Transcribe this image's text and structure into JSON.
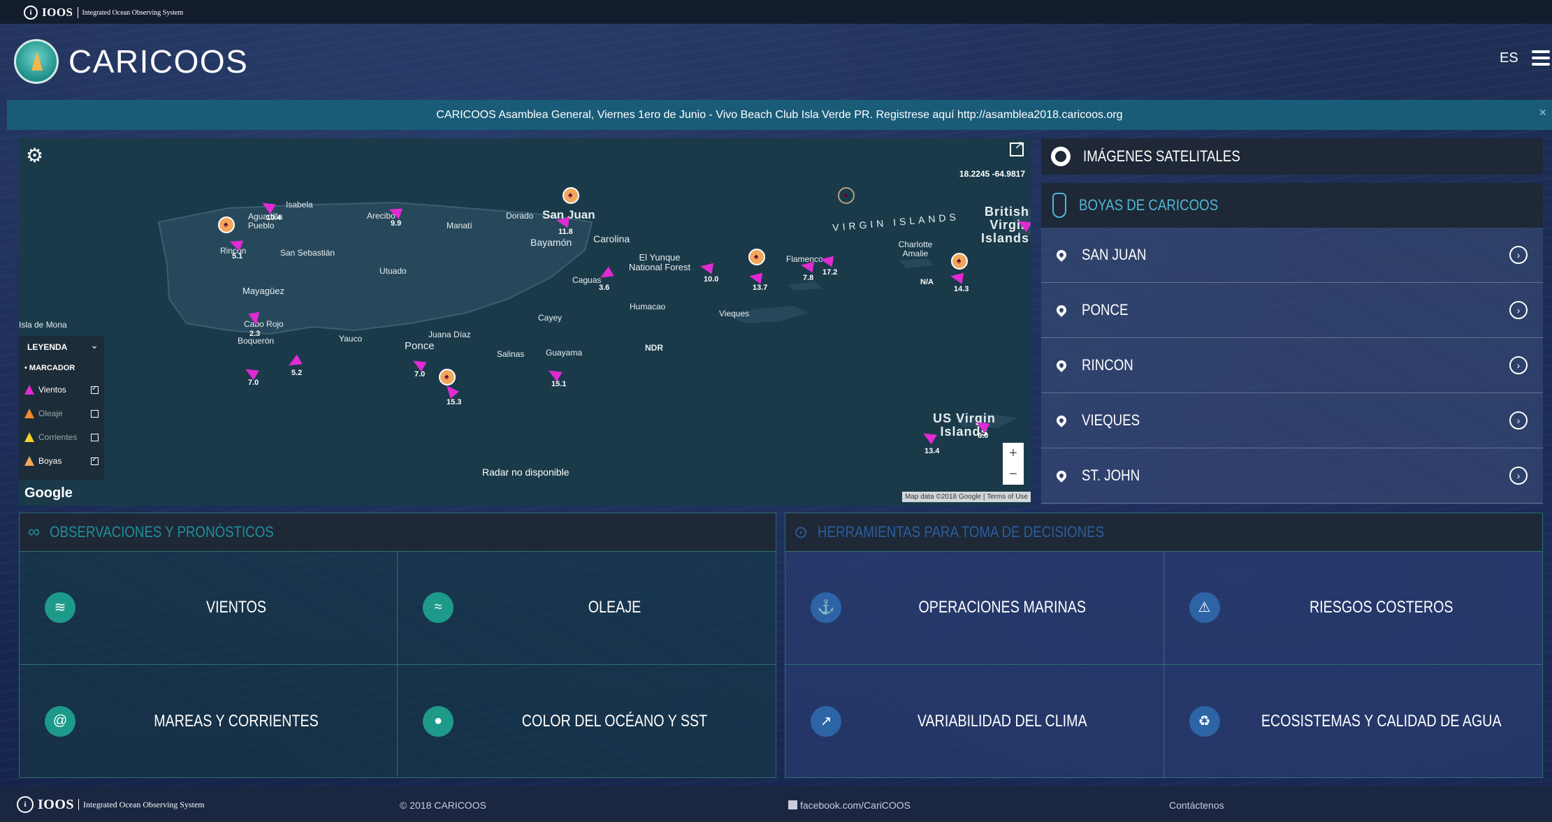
{
  "topbar": {
    "ioos_word": "IOOS",
    "ioos_tag": "Integrated Ocean Observing System"
  },
  "header": {
    "brand": "CARICOOS",
    "lang": "ES"
  },
  "announcement": {
    "text": "CARICOOS Asamblea General, Viernes 1ero de Junio - Vivo Beach Club Isla Verde PR. Registrese aquí http://asamblea2018.caricoos.org",
    "close": "×"
  },
  "map": {
    "coords": "18.2245 -64.9817",
    "places": [
      "Isabela",
      "Aguadilla Pueblo",
      "Rincón",
      "San Sebastián",
      "Arecibo",
      "Manatí",
      "Dorado",
      "San Juan",
      "Bayamón",
      "Carolina",
      "Utuado",
      "El Yunque National Forest",
      "Caguas",
      "Mayagüez",
      "Cayey",
      "Humacao",
      "Cabo Rojo",
      "Boquerón",
      "Yauco",
      "Juana Díaz",
      "Ponce",
      "Salinas",
      "Guayama",
      "Isla de Mona",
      "Vieques",
      "Flamenco",
      "Charlotte Amalie",
      "VIRGIN ISLANDS",
      "British Virgin Islands",
      "US Virgin Islands"
    ],
    "wind_values": [
      "10.4",
      "5.1",
      "9.9",
      "11.8",
      "3.6",
      "10.0",
      "13.7",
      "7.8",
      "17.2",
      "N/A",
      "14.3",
      "2.3",
      "7.0",
      "5.2",
      "7.0",
      "15.3",
      "15.1",
      "13.4",
      "6.0"
    ],
    "ndr": "NDR",
    "radar": "Radar no disponible",
    "google": "Google",
    "map_data": "Map data ©2018 Google",
    "terms": "Terms of Use",
    "zoom_in": "+",
    "zoom_out": "−"
  },
  "legend": {
    "title": "LEYENDA",
    "section": "• MARCADOR",
    "items": [
      "Vientos",
      "Oleaje",
      "Corrientes",
      "Boyas"
    ]
  },
  "sidebar": {
    "satellite": "IMÁGENES SATELITALES",
    "buoys_title": "BOYAS DE CARICOOS",
    "buoys": [
      "SAN JUAN",
      "PONCE",
      "RINCON",
      "VIEQUES",
      "ST. JOHN"
    ]
  },
  "observations": {
    "title": "OBSERVACIONES Y PRONÓSTICOS",
    "items": [
      "VIENTOS",
      "OLEAJE",
      "MAREAS Y CORRIENTES",
      "COLOR DEL OCÉANO Y SST"
    ]
  },
  "tools": {
    "title": "HERRAMIENTAS PARA TOMA DE DECISIONES",
    "items": [
      "OPERACIONES MARINAS",
      "RIESGOS COSTEROS",
      "VARIABILIDAD DEL CLIMA",
      "ECOSISTEMAS Y CALIDAD DE AGUA"
    ]
  },
  "footer": {
    "ioos_word": "IOOS",
    "ioos_tag": "Integrated Ocean Observing System",
    "copyright": "© 2018 CARICOOS",
    "facebook": "facebook.com/CariCOOS",
    "contact": "Contáctenos"
  },
  "colors": {
    "wind_marker": "#e02ad2",
    "buoy_marker": "#f2a75c",
    "announcement_bg": "#1a5c78",
    "obs_accent": "#1e9a8a",
    "tools_accent": "#2d64a6"
  }
}
